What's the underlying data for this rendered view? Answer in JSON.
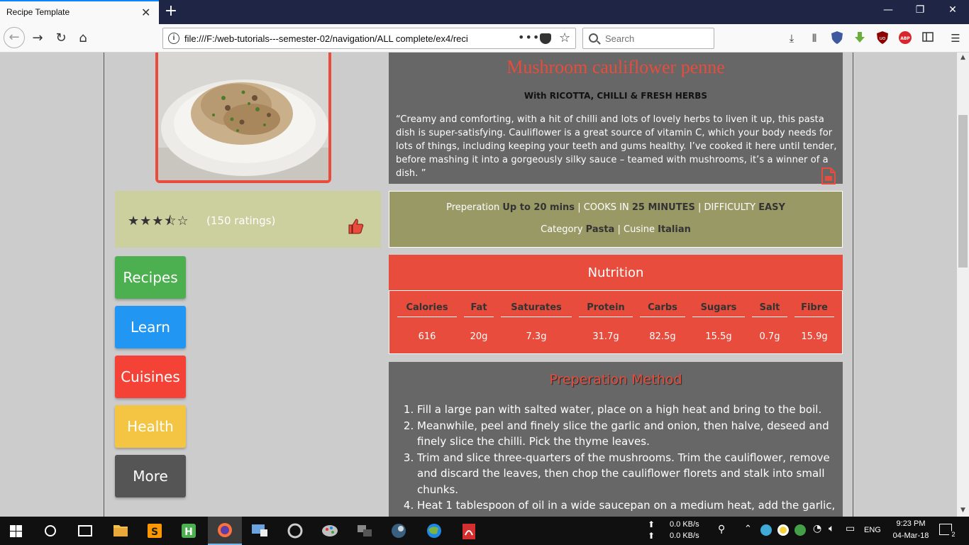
{
  "browser": {
    "tab_title": "Recipe Template",
    "url": "file:///F:/web-tutorials---semester-02/navigation/ALL complete/ex4/reci",
    "search_placeholder": "Search"
  },
  "recipe": {
    "title": "Mushroom cauliflower penne",
    "subtitle": "With RICOTTA, CHILLI & FRESH HERBS",
    "quote": "“Creamy and comforting, with a hit of chilli and lots of lovely herbs to liven it up, this pasta dish is super-satisfying. Cauliflower is a great source of vitamin C, which your body needs for lots of things, including keeping your teeth and gums healthy. I’ve cooked it here until tender, before mashing it into a gorgeously silky sauce – teamed with mushrooms, it’s a winner of a dish. ”",
    "rating_stars": 3.5,
    "ratings_count": "(150 ratings)"
  },
  "info": {
    "prep_label": "Preperation",
    "prep_value": "Up to 20 mins",
    "cooks_label": "COOKS IN",
    "cooks_value": "25 MINUTES",
    "difficulty_label": "DIFFICULTY",
    "difficulty_value": "EASY",
    "category_label": "Category",
    "category_value": "Pasta",
    "cuisine_label": "Cusine",
    "cuisine_value": "Italian",
    "separator": "|"
  },
  "sidebar": {
    "items": [
      {
        "label": "Recipes",
        "color": "#4caf50"
      },
      {
        "label": "Learn",
        "color": "#2196f3"
      },
      {
        "label": "Cuisines",
        "color": "#f44336"
      },
      {
        "label": "Health",
        "color": "#f4c542"
      },
      {
        "label": "More",
        "color": "#555555"
      }
    ]
  },
  "nutrition": {
    "title": "Nutrition",
    "columns": [
      {
        "head": "Calories",
        "value": "616"
      },
      {
        "head": "Fat",
        "value": "20g"
      },
      {
        "head": "Saturates",
        "value": "7.3g"
      },
      {
        "head": "Protein",
        "value": "31.7g"
      },
      {
        "head": "Carbs",
        "value": "82.5g"
      },
      {
        "head": "Sugars",
        "value": "15.5g"
      },
      {
        "head": "Salt",
        "value": "0.7g"
      },
      {
        "head": "Fibre",
        "value": "15.9g"
      }
    ]
  },
  "method": {
    "title": "Preperation Method",
    "steps": [
      "Fill a large pan with salted water, place on a high heat and bring to the boil.",
      "Meanwhile, peel and finely slice the garlic and onion, then halve, deseed and finely slice the chilli. Pick the thyme leaves.",
      "Trim and slice three-quarters of the mushrooms. Trim the cauliflower, remove and discard the leaves, then chop the cauliflower florets and stalk into small chunks.",
      "Heat 1 tablespoon of oil in a wide saucepan on a medium heat, add the garlic,"
    ]
  },
  "taskbar": {
    "net_up": "0.0 KB/s",
    "net_down": "0.0 KB/s",
    "lang": "ENG",
    "time": "9:23 PM",
    "date": "04-Mar-18",
    "notif_count": "2"
  },
  "colors": {
    "accent_red": "#e74c3c",
    "panel_grey": "#676767",
    "info_olive": "#999966",
    "rating_bg": "#cccf9e"
  }
}
